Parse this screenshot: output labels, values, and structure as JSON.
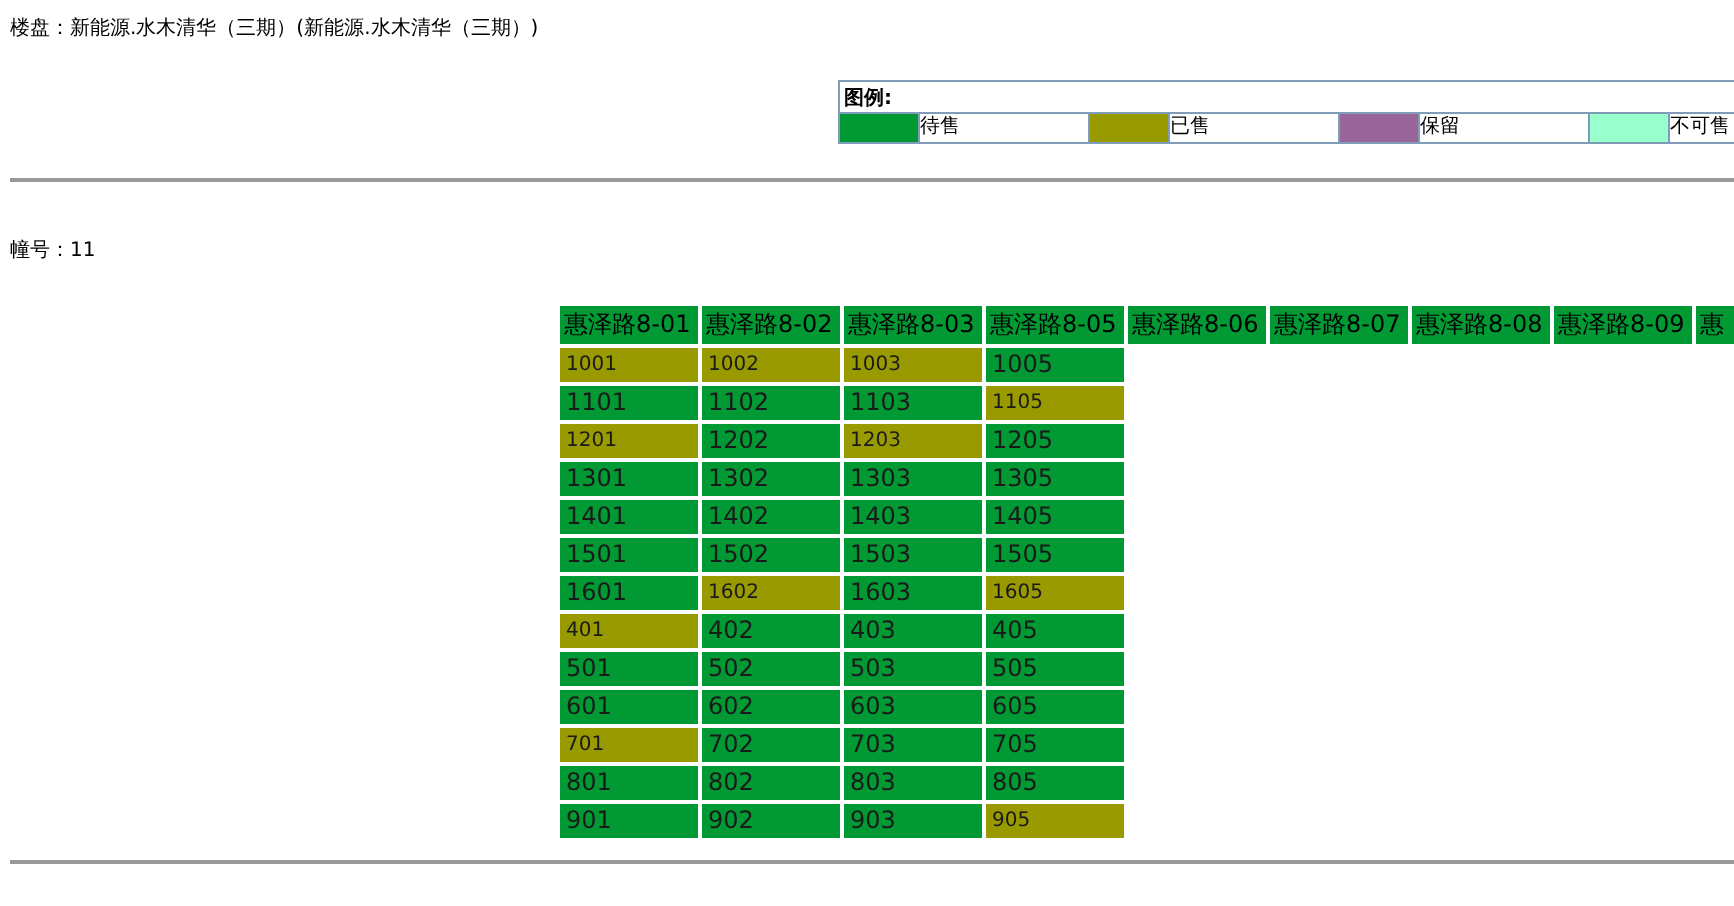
{
  "project_line": "楼盘：新能源.水木清华（三期）(新能源.水木清华（三期）)",
  "legend": {
    "title": "图例:",
    "items": [
      {
        "label": "待售",
        "color": "#009933"
      },
      {
        "label": "已售",
        "color": "#999900"
      },
      {
        "label": "保留",
        "color": "#996699"
      },
      {
        "label": "不可售",
        "color": "#99ffcc"
      }
    ]
  },
  "building_line": "幢号：11",
  "table": {
    "columns": [
      "惠泽路8-01",
      "惠泽路8-02",
      "惠泽路8-03",
      "惠泽路8-05",
      "惠泽路8-06",
      "惠泽路8-07",
      "惠泽路8-08",
      "惠泽路8-09",
      "惠"
    ],
    "rows": [
      [
        {
          "number": "1001",
          "sold": true
        },
        {
          "number": "1002",
          "sold": true
        },
        {
          "number": "1003",
          "sold": true
        },
        {
          "number": "1005",
          "sold": false
        }
      ],
      [
        {
          "number": "1101",
          "sold": false
        },
        {
          "number": "1102",
          "sold": false
        },
        {
          "number": "1103",
          "sold": false
        },
        {
          "number": "1105",
          "sold": true
        }
      ],
      [
        {
          "number": "1201",
          "sold": true
        },
        {
          "number": "1202",
          "sold": false
        },
        {
          "number": "1203",
          "sold": true
        },
        {
          "number": "1205",
          "sold": false
        }
      ],
      [
        {
          "number": "1301",
          "sold": false
        },
        {
          "number": "1302",
          "sold": false
        },
        {
          "number": "1303",
          "sold": false
        },
        {
          "number": "1305",
          "sold": false
        }
      ],
      [
        {
          "number": "1401",
          "sold": false
        },
        {
          "number": "1402",
          "sold": false
        },
        {
          "number": "1403",
          "sold": false
        },
        {
          "number": "1405",
          "sold": false
        }
      ],
      [
        {
          "number": "1501",
          "sold": false
        },
        {
          "number": "1502",
          "sold": false
        },
        {
          "number": "1503",
          "sold": false
        },
        {
          "number": "1505",
          "sold": false
        }
      ],
      [
        {
          "number": "1601",
          "sold": false
        },
        {
          "number": "1602",
          "sold": true
        },
        {
          "number": "1603",
          "sold": false
        },
        {
          "number": "1605",
          "sold": true
        }
      ],
      [
        {
          "number": "401",
          "sold": true
        },
        {
          "number": "402",
          "sold": false
        },
        {
          "number": "403",
          "sold": false
        },
        {
          "number": "405",
          "sold": false
        }
      ],
      [
        {
          "number": "501",
          "sold": false
        },
        {
          "number": "502",
          "sold": false
        },
        {
          "number": "503",
          "sold": false
        },
        {
          "number": "505",
          "sold": false
        }
      ],
      [
        {
          "number": "601",
          "sold": false
        },
        {
          "number": "602",
          "sold": false
        },
        {
          "number": "603",
          "sold": false
        },
        {
          "number": "605",
          "sold": false
        }
      ],
      [
        {
          "number": "701",
          "sold": true
        },
        {
          "number": "702",
          "sold": false
        },
        {
          "number": "703",
          "sold": false
        },
        {
          "number": "705",
          "sold": false
        }
      ],
      [
        {
          "number": "801",
          "sold": false
        },
        {
          "number": "802",
          "sold": false
        },
        {
          "number": "803",
          "sold": false
        },
        {
          "number": "805",
          "sold": false
        }
      ],
      [
        {
          "number": "901",
          "sold": false
        },
        {
          "number": "902",
          "sold": false
        },
        {
          "number": "903",
          "sold": false
        },
        {
          "number": "905",
          "sold": true
        }
      ]
    ]
  }
}
